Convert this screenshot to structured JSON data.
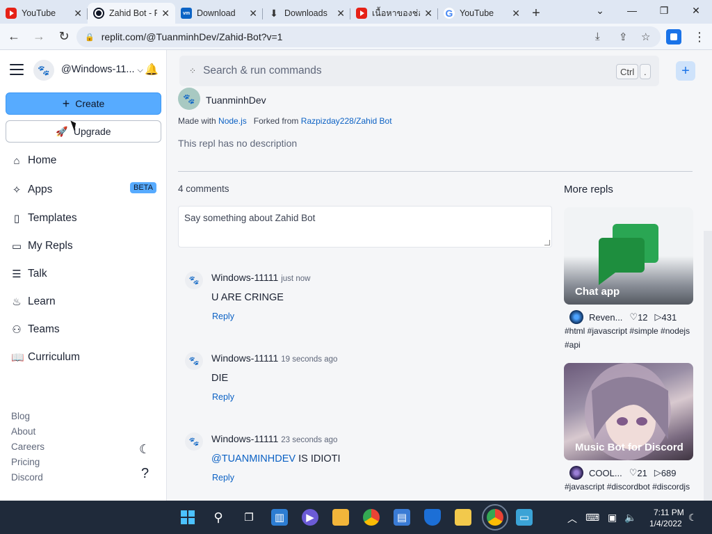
{
  "browser": {
    "tabs": [
      {
        "title": "YouTube",
        "icon": "youtube-icon"
      },
      {
        "title": "Zahid Bot - Replit",
        "icon": "replit-icon"
      },
      {
        "title": "Download",
        "icon": "vmware-icon"
      },
      {
        "title": "Downloads",
        "icon": "download-icon"
      },
      {
        "title": "เนื้อหาของช่อง",
        "icon": "youtube-icon"
      },
      {
        "title": "YouTube",
        "icon": "google-icon"
      }
    ],
    "url": "replit.com/@TuanminhDev/Zahid-Bot?v=1",
    "vmware_label": "vm"
  },
  "sidebar": {
    "username": "@Windows-11...",
    "create_label": "Create",
    "upgrade_label": "Upgrade",
    "beta_badge": "BETA",
    "items": [
      {
        "label": "Home"
      },
      {
        "label": "Apps"
      },
      {
        "label": "Templates"
      },
      {
        "label": "My Repls"
      },
      {
        "label": "Talk"
      },
      {
        "label": "Learn"
      },
      {
        "label": "Teams"
      },
      {
        "label": "Curriculum"
      }
    ],
    "footer_links": [
      "Blog",
      "About",
      "Careers",
      "Pricing",
      "Discord"
    ]
  },
  "search": {
    "placeholder": "Search & run commands",
    "shortcut_key1": "Ctrl",
    "shortcut_key2": "."
  },
  "repl": {
    "author": "TuanminhDev",
    "made_with_prefix": "Made with",
    "language": "Node.js",
    "forked_prefix": "Forked from",
    "forked_from": "Razpizday228/Zahid Bot",
    "description": "This repl has no description"
  },
  "comments": {
    "count_label": "4 comments",
    "placeholder": "Say something about Zahid Bot",
    "reply_label": "Reply",
    "items": [
      {
        "author": "Windows-11111",
        "time": "just now",
        "text": "U ARE CRINGE"
      },
      {
        "author": "Windows-11111",
        "time": "19 seconds ago",
        "text": "DIE"
      },
      {
        "author": "Windows-11111",
        "time": "23 seconds ago",
        "mention": "@TUANMINHDEV",
        "text": " IS IDIOTI"
      }
    ]
  },
  "more_repls": {
    "title": "More repls",
    "cards": [
      {
        "title": "Chat app",
        "author": "Reven...",
        "likes": "12",
        "runs": "431",
        "tags": "#html #javascript #simple #nodejs #api"
      },
      {
        "title": "Music Bot for Discord",
        "author": "COOL...",
        "likes": "21",
        "runs": "689",
        "tags": "#javascript #discordbot #discordjs"
      }
    ]
  },
  "taskbar": {
    "time": "7:11 PM",
    "date": "1/4/2022"
  },
  "colors": {
    "accent": "#57abff",
    "link": "#0b61c4",
    "taskbar": "#1f2a3a"
  }
}
